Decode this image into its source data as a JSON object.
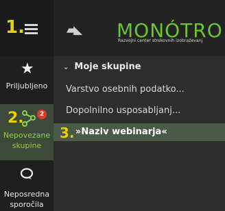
{
  "steps": {
    "one": "1.",
    "two": "2.",
    "three": "3."
  },
  "brand": {
    "name": "MONÓTRO",
    "tagline": "Razvojni center strokovnih izobraževanj"
  },
  "icons": {
    "menu": "hamburger-icon",
    "ms": "ms-teams-icon",
    "favorite": "star-icon",
    "groups": "nodes-icon",
    "messages": "chat-bubble-icon"
  },
  "sidebar": {
    "favorites": "Priljubljeno",
    "groups_line1": "Nepovezane",
    "groups_line2": "skupine",
    "groups_badge": "2",
    "messages_line1": "Neposredna",
    "messages_line2": "sporočila"
  },
  "panel": {
    "section_title": "Moje skupine",
    "items": [
      "Varstvo osebnih podatko...",
      "Dopolnilno usposabljanj...",
      "»Naziv webinarja«"
    ]
  },
  "colors": {
    "accent_yellow": "#e8d000",
    "brand_green": "#6cc534",
    "badge_red": "#e03a2e"
  }
}
